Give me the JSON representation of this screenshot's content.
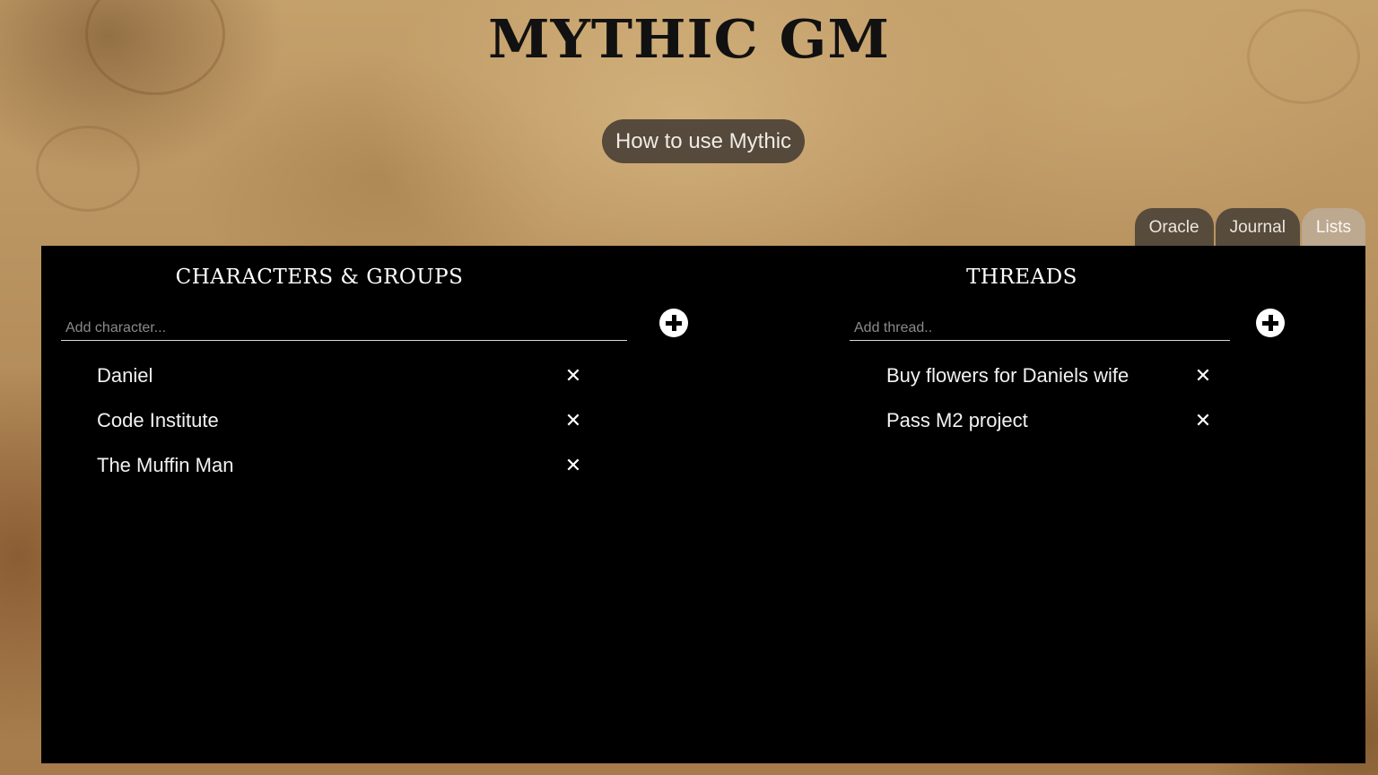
{
  "app": {
    "title": "MYTHIC GM",
    "help_button": "How to use Mythic"
  },
  "tabs": [
    {
      "label": "Oracle",
      "active": false
    },
    {
      "label": "Journal",
      "active": false
    },
    {
      "label": "Lists",
      "active": true
    }
  ],
  "characters": {
    "heading": "CHARACTERS & GROUPS",
    "placeholder": "Add character...",
    "items": [
      "Daniel",
      "Code Institute",
      "The Muffin Man"
    ]
  },
  "threads": {
    "heading": "THREADS",
    "placeholder": "Add thread..",
    "items": [
      "Buy flowers for Daniels wife",
      "Pass M2 project"
    ]
  },
  "icons": {
    "add": "plus-circle-icon",
    "delete": "close-icon"
  },
  "colors": {
    "panel_background": "#000000",
    "tab_inactive": "#4e443a",
    "tab_active": "#beaa96",
    "help_button_background": "#3a342e"
  }
}
